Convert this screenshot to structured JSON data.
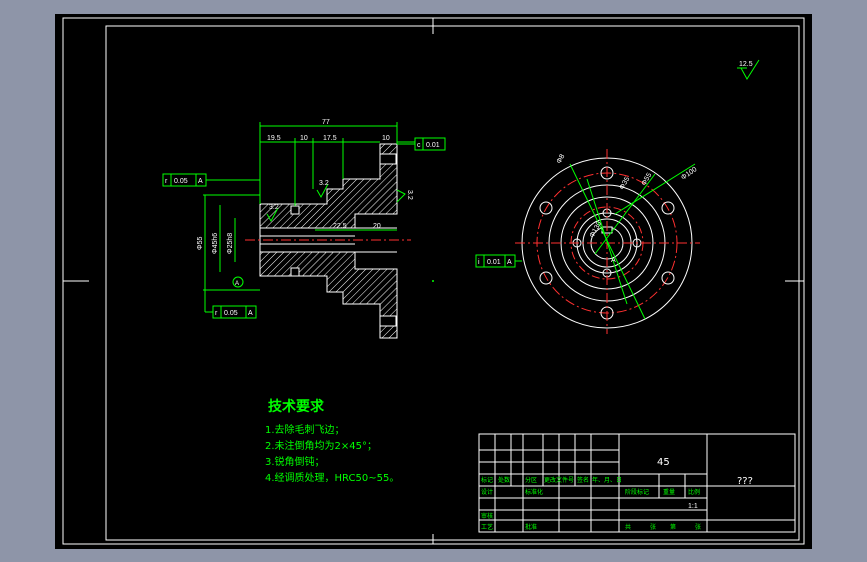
{
  "drawing": {
    "material": "45",
    "drawing_name": "???",
    "scale": "1:1"
  },
  "tech_req": {
    "title": "技术要求",
    "items": [
      "1.去除毛刺飞边；",
      "2.未注倒角均为2×45°；",
      "3.锐角倒钝；",
      "4.经调质处理，HRC50~55。"
    ]
  },
  "title_block": {
    "mark": "标记",
    "count": "处数",
    "zone": "分区",
    "change_doc": "更改文件号",
    "signature": "签名",
    "date": "年、月、日",
    "design": "设计",
    "standardize": "标准化",
    "stage_mark": "阶段标记",
    "weight": "重量",
    "scale_label": "比例",
    "review": "审核",
    "process": "工艺",
    "approve": "批准",
    "sheet_total": "共",
    "sheet_word": "张",
    "sheet_no": "第",
    "sheet_word2": "张"
  },
  "side_view": {
    "dims": {
      "overall": "77",
      "d19_5": "19.5",
      "d10a": "10",
      "d17_5": "17.5",
      "d10b": "10",
      "d22_5": "22.5",
      "d20": "20",
      "dia55": "Φ55",
      "dia45": "Φ45h6",
      "dia25": "Φ25h8",
      "rough32a": "3.2",
      "rough32b": "3.2",
      "rough_side": "3.2"
    },
    "tol_top": {
      "sym": "c",
      "val": "0.01"
    },
    "tol_runout1": {
      "sym": "r",
      "val": "0.05",
      "datum": "A"
    },
    "tol_runout2": {
      "sym": "r",
      "val": "0.05",
      "datum": "A"
    }
  },
  "front_view": {
    "dims": {
      "d8": "Φ8",
      "d35": "Φ35",
      "d55": "Φ55",
      "d100": "Φ100",
      "d130": "Φ130",
      "key": "A"
    },
    "tol": {
      "sym": "i",
      "val": "0.01",
      "datum": "A"
    }
  },
  "roughness_corner": "12.5"
}
